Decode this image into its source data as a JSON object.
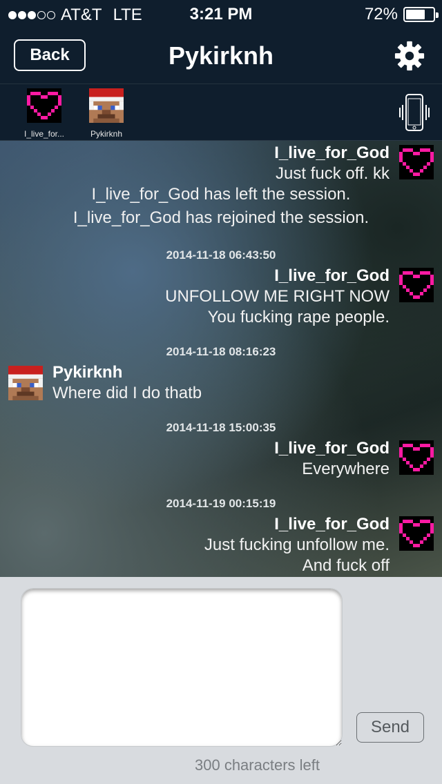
{
  "status_bar": {
    "signal_filled": 3,
    "signal_total": 5,
    "carrier": "AT&T",
    "network": "LTE",
    "time": "3:21 PM",
    "battery_percent": "72%",
    "battery_level": 0.72
  },
  "nav": {
    "back_label": "Back",
    "title": "Pykirknh",
    "settings_icon": "gear-icon"
  },
  "participants": [
    {
      "name": "I_live_for...",
      "avatar": "pink-heart-avatar"
    },
    {
      "name": "Pykirknh",
      "avatar": "santa-steve-avatar"
    }
  ],
  "vibrate_icon": "phone-vibrate-icon",
  "messages": {
    "m1": {
      "sender": "I_live_for_God",
      "line1": "Just fuck off.  kk"
    },
    "sys1": "I_live_for_God has left the session.",
    "sys2": "I_live_for_God has rejoined the session.",
    "ts1": "2014-11-18 06:43:50",
    "m2": {
      "sender": "I_live_for_God",
      "line1": "UNFOLLOW ME RIGHT NOW",
      "line2": "You fucking rape people."
    },
    "ts2": "2014-11-18 08:16:23",
    "m3": {
      "sender": "Pykirknh",
      "line1": "Where did I do thatb"
    },
    "ts3": "2014-11-18 15:00:35",
    "m4": {
      "sender": "I_live_for_God",
      "line1": "Everywhere"
    },
    "ts4": "2014-11-19 00:15:19",
    "m5": {
      "sender": "I_live_for_God",
      "line1": "Just fucking unfollow me.",
      "line2": "And fuck off"
    }
  },
  "compose": {
    "input_value": "",
    "send_label": "Send",
    "chars_left": "300 characters left"
  },
  "colors": {
    "heart_pink": "#ff1aa3",
    "bar_bg": "#0f1e2d",
    "compose_bg": "#d8dbdf"
  }
}
